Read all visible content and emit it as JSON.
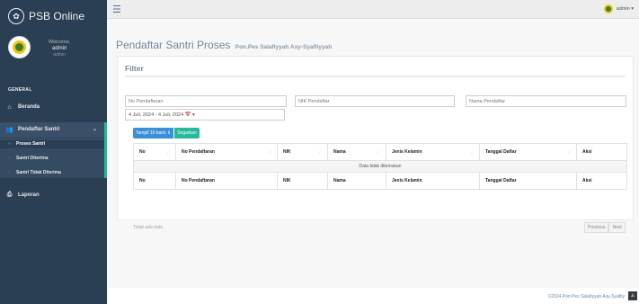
{
  "brand": {
    "title": "PSB Online",
    "icon": "paw-icon"
  },
  "profile": {
    "welcome": "Welcome,",
    "name": "admin",
    "role": "admin"
  },
  "sidebar": {
    "section": "GENERAL",
    "items": [
      {
        "label": "Beranda",
        "icon": "home-icon"
      },
      {
        "label": "Pendaftar Santri",
        "icon": "users-icon",
        "sub": [
          "Proses Santri",
          "Santri Diterima",
          "Santri Tidak Diterima"
        ]
      },
      {
        "label": "Laporan",
        "icon": "printer-icon"
      }
    ]
  },
  "topnav": {
    "user": "admin ▾"
  },
  "page": {
    "title": "Pendaftar Santri Proses",
    "subtitle": "Pon.Pes Salafiyyah Asy-Syafiiyyah"
  },
  "filter": {
    "title": "Filter",
    "no_placeholder": "No Pendaftaran",
    "nik_placeholder": "NIK Pendaftar",
    "nama_placeholder": "Nama Pendaftar",
    "date_range": "4 Juli, 2024 - 4 Juli, 2024 📅 ▾",
    "btn_show": "Tampil 10 baris ⇕",
    "btn_refresh": "Segarkan"
  },
  "table": {
    "headers": [
      "No",
      "No Pendaftaran",
      "NIK",
      "Nama",
      "Jenis Kelamin",
      "Tanggal Daftar",
      "Aksi"
    ],
    "empty": "Data tidak ditemukan",
    "info": "Tidak ada data",
    "prev": "Previous",
    "next": "Next"
  },
  "footer": {
    "copy": "©2024 Pon.Pes Salafiyyah Asy-Syafiiy"
  },
  "colors": {
    "sidebar": "#2a3f54",
    "accent": "#1abb9c",
    "blue": "#3b8fd9",
    "teal": "#26b99a"
  }
}
